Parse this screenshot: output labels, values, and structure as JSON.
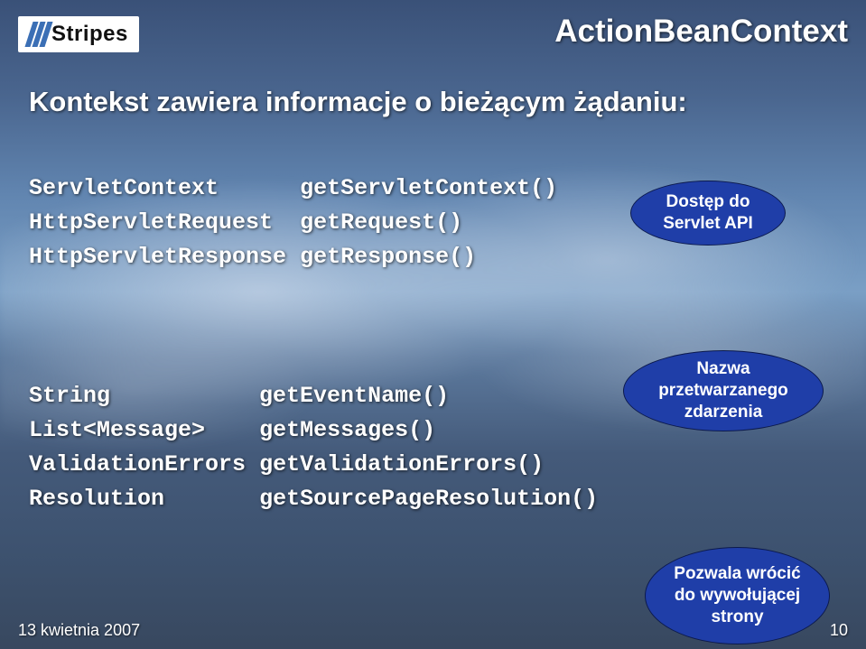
{
  "logo_text": "Stripes",
  "title": "ActionBeanContext",
  "subtitle": "Kontekst zawiera informacje o bieżącym żądaniu:",
  "block1": [
    {
      "type": "ServletContext",
      "method": "getServletContext()"
    },
    {
      "type": "HttpServletRequest",
      "method": "getRequest()"
    },
    {
      "type": "HttpServletResponse",
      "method": "getResponse()"
    }
  ],
  "block2": [
    {
      "type": "String",
      "method": "getEventName()"
    },
    {
      "type": "List<Message>",
      "method": "getMessages()"
    },
    {
      "type": "ValidationErrors",
      "method": "getValidationErrors()"
    },
    {
      "type": "Resolution",
      "method": "getSourcePageResolution()"
    }
  ],
  "bubbles": {
    "b1": "Dostęp do Servlet API",
    "b2": "Nazwa przetwarzanego zdarzenia",
    "b3": "Pozwala wrócić do wywołującej strony"
  },
  "footer_left": "13 kwietnia 2007",
  "footer_right": "10"
}
